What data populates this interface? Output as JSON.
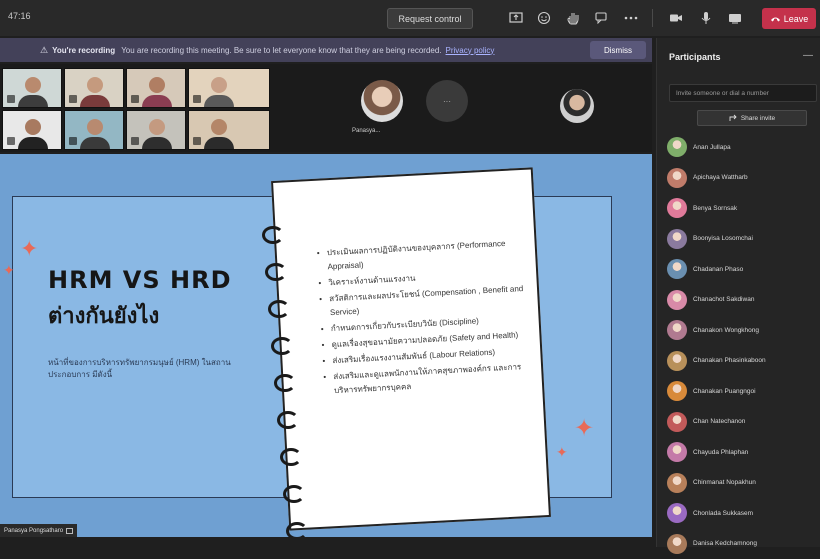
{
  "topbar": {
    "timer": "47:16",
    "request_control_label": "Request control",
    "leave_label": "Leave",
    "colors": {
      "leave": "#c4314b",
      "bar": "#292929"
    }
  },
  "recording_banner": {
    "title": "You're recording",
    "text": "You are recording this meeting. Be sure to let everyone know that they are being recorded.",
    "link": "Privacy policy",
    "dismiss_label": "Dismiss"
  },
  "gallery": {
    "featured_name": "Panasya...",
    "tiles": [
      {
        "skin": "#b98a6e",
        "shirt": "#3d3d3d",
        "bg": "#cfd8d6"
      },
      {
        "skin": "#c59a7e",
        "shirt": "#7a3b3b",
        "bg": "#d9d2c4"
      },
      {
        "skin": "#b07e63",
        "shirt": "#8a3d52",
        "bg": "#d6c9b9"
      },
      {
        "skin": "#c8a088",
        "shirt": "#5a5a5a",
        "bg": "#e3d3bd"
      },
      {
        "skin": "#a87a60",
        "shirt": "#222222",
        "bg": "#e8e8e8"
      },
      {
        "skin": "#b88a70",
        "shirt": "#3a3a3a",
        "bg": "#93b7c4"
      },
      {
        "skin": "#c49a80",
        "shirt": "#2e2e2e",
        "bg": "#c4c2bb"
      },
      {
        "skin": "#b48668",
        "shirt": "#2b2b2b",
        "bg": "#d8c8b2"
      }
    ]
  },
  "slide": {
    "title_line1": "HRM VS HRD",
    "title_line2": "ต่างกันยังไง",
    "subtitle": "หน้าที่ของการบริหารทรัพยากรมนุษย์ (HRM) ในสถานประกอบการ มีดังนี้",
    "bullets": [
      "ประเมินผลการปฏิบัติงานของบุคลากร (Performance Appraisal)",
      "วิเคราะห์งานด้านแรงงาน",
      "สวัสดิการและผลประโยชน์ (Compensation , Benefit and Service)",
      "กำหนดการเกี่ยวกับระเบียบวินัย (Discipline)",
      "ดูแลเรื่องสุขอนามัยความปลอดภัย (Safety and Health)",
      "ส่งเสริมเรื่องแรงงานสัมพันธ์ (Labour Relations)",
      "ส่งเสริมและดูแลพนักงานให้ภาคสุขภาพองค์กร และการบริหารทรัพยากรบุคคล"
    ],
    "presenter_label": "Panasya Pongsatharo",
    "colors": {
      "background": "#6fa0d2",
      "frame": "#8ab8e4",
      "accent": "#e86a58"
    }
  },
  "panel": {
    "title": "Participants",
    "invite_placeholder": "Invite someone or dial a number",
    "share_invite_label": "Share invite",
    "participants": [
      {
        "name": "Anan Jullapa",
        "color": "#7fae6a"
      },
      {
        "name": "Apichaya Wattharb",
        "color": "#c07c6a"
      },
      {
        "name": "Benya Sornsak",
        "color": "#e07a9a"
      },
      {
        "name": "Boonyisa Losomchai",
        "color": "#8a7a9e"
      },
      {
        "name": "Chadanan Phaso",
        "color": "#6a8fb0"
      },
      {
        "name": "Chanachot Sakdiwan",
        "color": "#d88aa8"
      },
      {
        "name": "Chanakon Wongkhong",
        "color": "#b07a90"
      },
      {
        "name": "Chanakan Phasinkaboon",
        "color": "#b8905a"
      },
      {
        "name": "Chanakan Puangngoi",
        "color": "#d88a3a"
      },
      {
        "name": "Chan Natechanon",
        "color": "#c25a5a"
      },
      {
        "name": "Chayuda Phlaphan",
        "color": "#c47aa8"
      },
      {
        "name": "Chinmanat Nopakhun",
        "color": "#b8805a"
      },
      {
        "name": "Chonlada Sukkasem",
        "color": "#9a6ac2"
      },
      {
        "name": "Danisa Kedchamnong",
        "color": "#a87a5a"
      }
    ]
  }
}
